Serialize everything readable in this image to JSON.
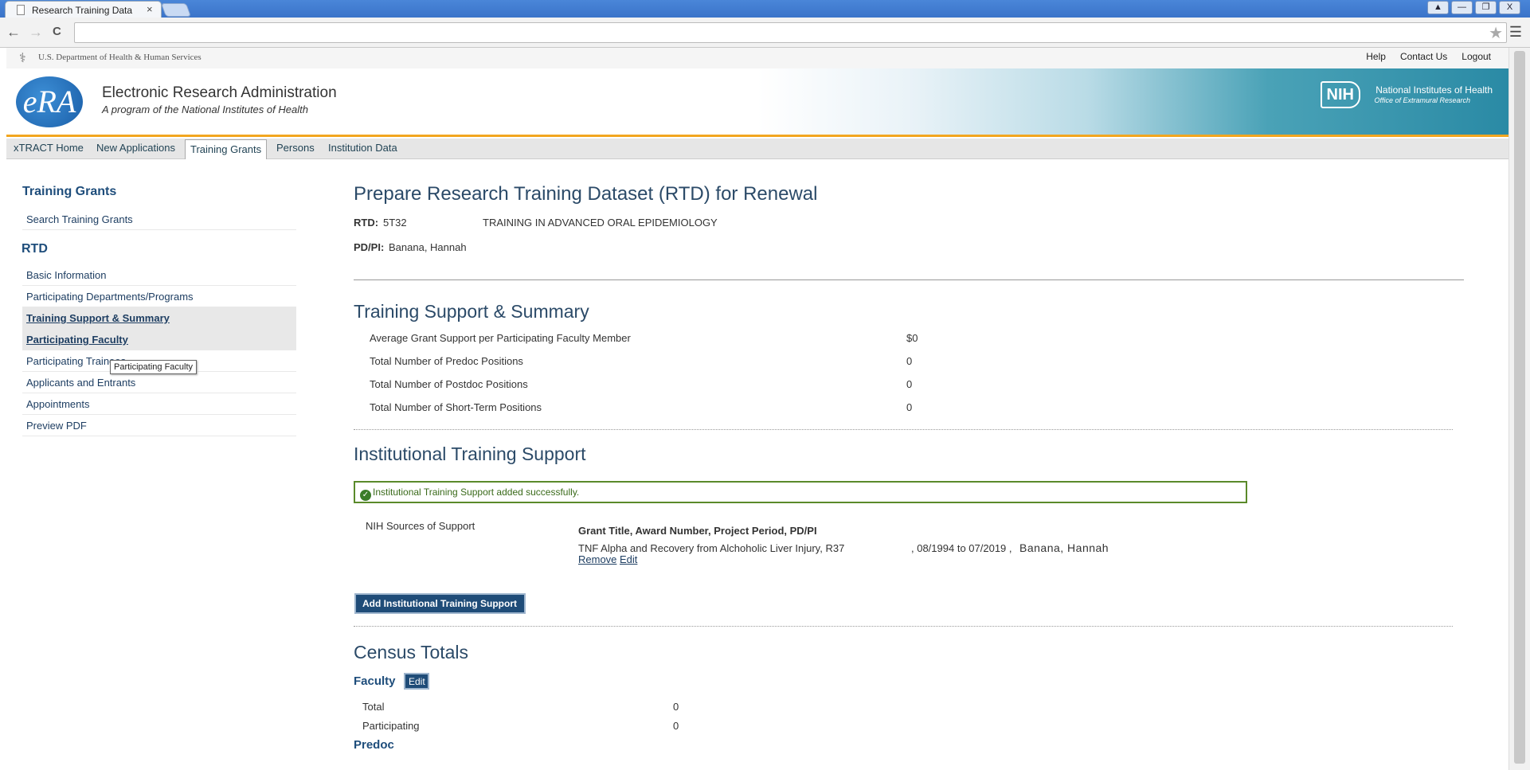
{
  "browser": {
    "tab_title": "Research Training Data",
    "tab_close": "×",
    "back": "←",
    "forward": "→",
    "reload": "C",
    "star": "★",
    "menu": "☰",
    "window_buttons": [
      "▲",
      "—",
      "❐",
      "X"
    ]
  },
  "hhs": {
    "text": "U.S. Department of Health & Human Services"
  },
  "toplinks": [
    "Help",
    "Contact Us",
    "Logout"
  ],
  "banner": {
    "logo": "eRA",
    "title": "Electronic Research Administration",
    "subtitle": "A program of the National Institutes of Health",
    "nih_mark": "NIH",
    "nih_title": "National Institutes of Health",
    "nih_subtitle": "Office of Extramural Research"
  },
  "mainnav": [
    "xTRACT Home",
    "New Applications",
    "Training Grants",
    "Persons",
    "Institution Data"
  ],
  "sidebar": {
    "heading1": "Training Grants",
    "search": "Search Training Grants",
    "heading2": "RTD",
    "items": [
      "Basic Information",
      "Participating Departments/Programs",
      "Training Support & Summary",
      "Participating Faculty",
      "Participating Trainees",
      "Applicants and Entrants",
      "Appointments",
      "Preview PDF"
    ],
    "tooltip": "Participating Faculty"
  },
  "main": {
    "title": "Prepare Research Training Dataset (RTD) for Renewal",
    "rtd_label": "RTD:",
    "rtd_value": "5T32",
    "rtd_title": "TRAINING IN ADVANCED ORAL EPIDEMIOLOGY",
    "pdpi_label": "PD/PI:",
    "pdpi_value": "Banana, Hannah",
    "tss_heading": "Training Support & Summary",
    "tss_rows": [
      {
        "label": "Average Grant Support per Participating Faculty Member",
        "value": "$0"
      },
      {
        "label": "Total Number of Predoc Positions",
        "value": "0"
      },
      {
        "label": "Total Number of Postdoc Positions",
        "value": "0"
      },
      {
        "label": "Total Number of Short-Term Positions",
        "value": "0"
      }
    ],
    "its_heading": "Institutional Training Support",
    "success_msg": "Institutional Training Support added successfully.",
    "nih_sources_label": "NIH Sources of Support",
    "grant_header": "Grant Title, Award Number, Project Period, PD/PI",
    "grant_line": "TNF Alpha and Recovery from Alchoholic Liver Injury, R37",
    "grant_period": ", 08/1994 to 07/2019 ,",
    "grant_pi": "Banana, Hannah",
    "remove": "Remove",
    "edit": "Edit",
    "add_button": "Add Institutional Training Support",
    "census_heading": "Census Totals",
    "faculty_heading": "Faculty",
    "faculty_edit": "Edit",
    "faculty_rows": [
      {
        "label": "Total",
        "value": "0"
      },
      {
        "label": "Participating",
        "value": "0"
      }
    ],
    "predoc_heading": "Predoc"
  }
}
